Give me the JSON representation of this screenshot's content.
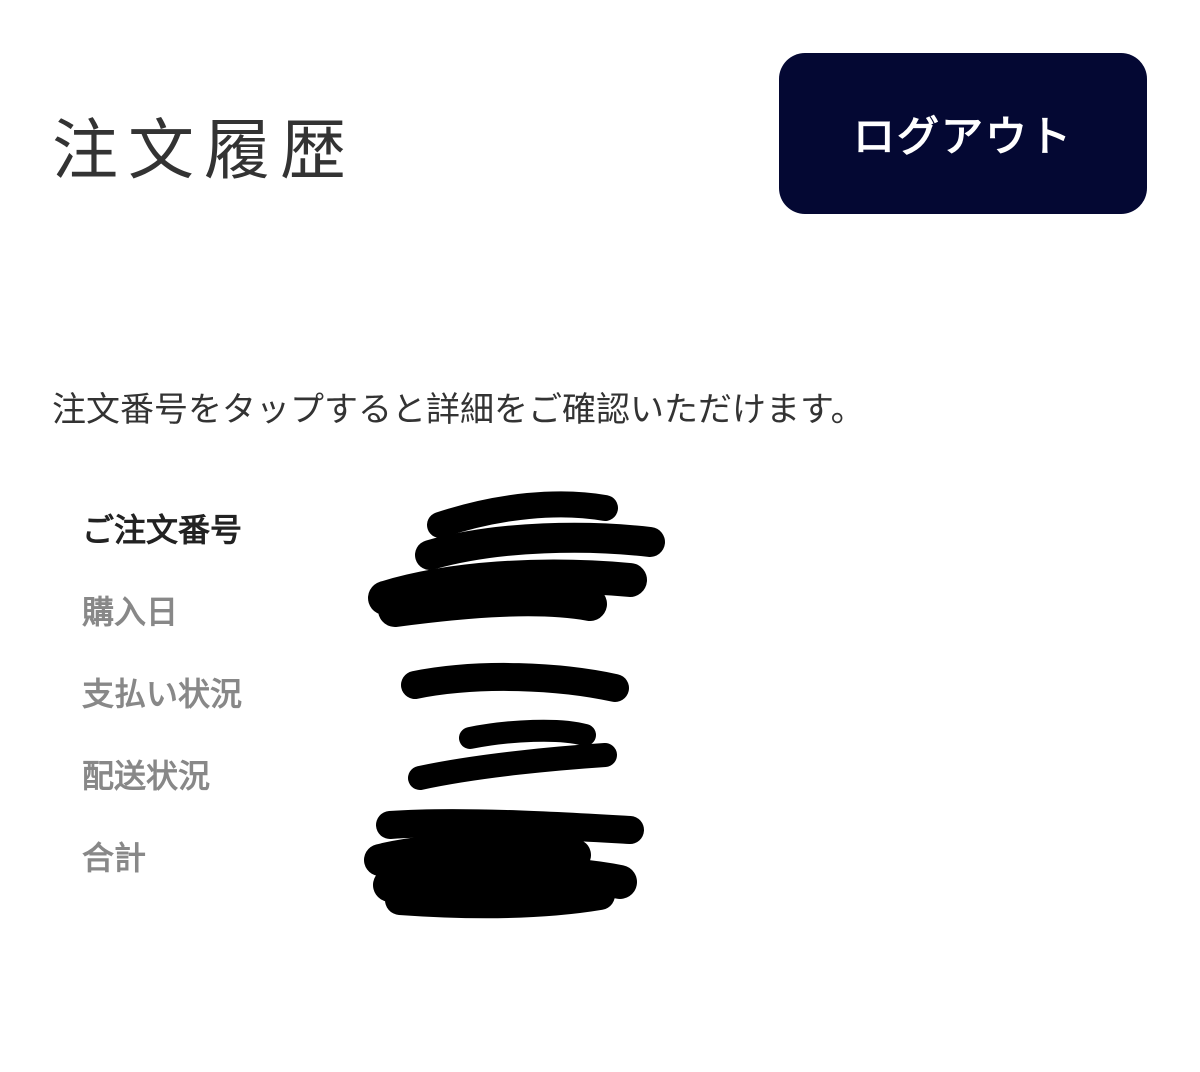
{
  "header": {
    "title": "注文履歴",
    "logout_label": "ログアウト"
  },
  "instruction": "注文番号をタップすると詳細をご確認いただけます。",
  "order": {
    "rows": [
      {
        "label": "ご注文番号",
        "value": ""
      },
      {
        "label": "購入日",
        "value": ""
      },
      {
        "label": "支払い状況",
        "value": ""
      },
      {
        "label": "配送状況",
        "value": ""
      },
      {
        "label": "合計",
        "value": ""
      }
    ]
  },
  "colors": {
    "button_bg": "#040833",
    "button_text": "#ffffff",
    "label_primary": "#222222",
    "label_secondary": "#888888",
    "redaction": "#000000"
  }
}
